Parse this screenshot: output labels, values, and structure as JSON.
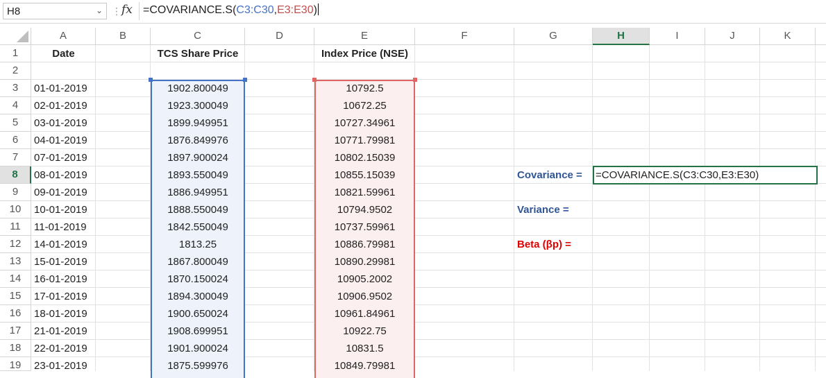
{
  "formula_bar": {
    "name_box": "H8",
    "fx_label": "fx",
    "formula_prefix": "=COVARIANCE.S(",
    "formula_ref1": "C3:C30",
    "formula_comma": ",",
    "formula_ref2": "E3:E30",
    "formula_suffix": ")"
  },
  "columns": [
    "A",
    "B",
    "C",
    "D",
    "E",
    "F",
    "G",
    "H",
    "I",
    "J",
    "K"
  ],
  "active_column": "H",
  "rows": [
    "1",
    "2",
    "3",
    "4",
    "5",
    "6",
    "7",
    "8",
    "9",
    "10",
    "11",
    "12",
    "13",
    "14",
    "15",
    "16",
    "17",
    "18",
    "19"
  ],
  "active_row": "8",
  "headers": {
    "date": "Date",
    "tcs": "TCS Share Price",
    "index": "Index Price (NSE)"
  },
  "data": [
    {
      "date": "01-01-2019",
      "tcs": "1902.800049",
      "index": "10792.5"
    },
    {
      "date": "02-01-2019",
      "tcs": "1923.300049",
      "index": "10672.25"
    },
    {
      "date": "03-01-2019",
      "tcs": "1899.949951",
      "index": "10727.34961"
    },
    {
      "date": "04-01-2019",
      "tcs": "1876.849976",
      "index": "10771.79981"
    },
    {
      "date": "07-01-2019",
      "tcs": "1897.900024",
      "index": "10802.15039"
    },
    {
      "date": "08-01-2019",
      "tcs": "1893.550049",
      "index": "10855.15039"
    },
    {
      "date": "09-01-2019",
      "tcs": "1886.949951",
      "index": "10821.59961"
    },
    {
      "date": "10-01-2019",
      "tcs": "1888.550049",
      "index": "10794.9502"
    },
    {
      "date": "11-01-2019",
      "tcs": "1842.550049",
      "index": "10737.59961"
    },
    {
      "date": "14-01-2019",
      "tcs": "1813.25",
      "index": "10886.79981"
    },
    {
      "date": "15-01-2019",
      "tcs": "1867.800049",
      "index": "10890.29981"
    },
    {
      "date": "16-01-2019",
      "tcs": "1870.150024",
      "index": "10905.2002"
    },
    {
      "date": "17-01-2019",
      "tcs": "1894.300049",
      "index": "10906.9502"
    },
    {
      "date": "18-01-2019",
      "tcs": "1900.650024",
      "index": "10961.84961"
    },
    {
      "date": "21-01-2019",
      "tcs": "1908.699951",
      "index": "10922.75"
    },
    {
      "date": "22-01-2019",
      "tcs": "1901.900024",
      "index": "10831.5"
    },
    {
      "date": "23-01-2019",
      "tcs": "1875.599976",
      "index": "10849.79981"
    }
  ],
  "labels": {
    "covariance": "Covariance =",
    "variance": "Variance =",
    "beta": "Beta (βp) ="
  },
  "active_cell_value": "=COVARIANCE.S(C3:C30,E3:E30)",
  "colors": {
    "accent_green": "#217346",
    "range_blue": "#4472c4",
    "range_red": "#e06666",
    "label_blue": "#2f5597",
    "label_red": "#e00000"
  }
}
